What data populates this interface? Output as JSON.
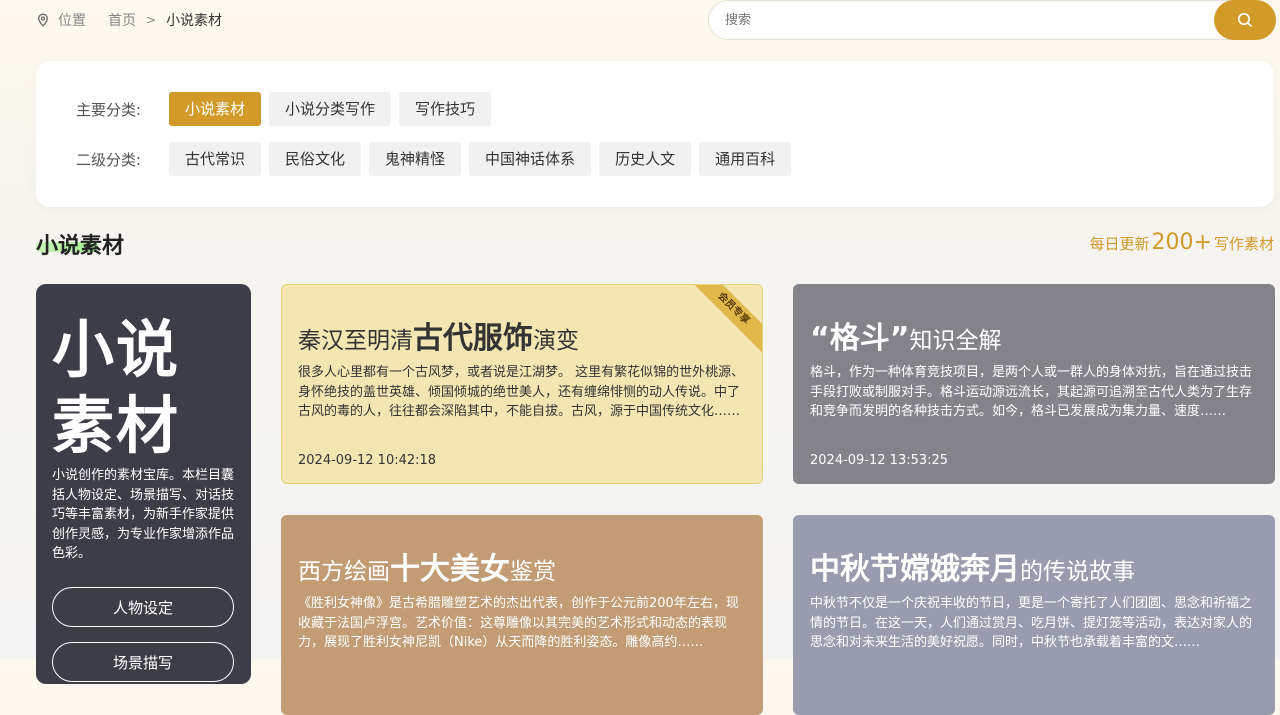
{
  "breadcrumb": {
    "location": "位置",
    "home": "首页",
    "separator": ">",
    "current": "小说素材"
  },
  "search": {
    "placeholder": "搜索"
  },
  "filters": {
    "primary_label": "主要分类:",
    "primary": [
      "小说素材",
      "小说分类写作",
      "写作技巧"
    ],
    "primary_active": "小说素材",
    "secondary_label": "二级分类:",
    "secondary": [
      "古代常识",
      "民俗文化",
      "鬼神精怪",
      "中国神话体系",
      "历史人文",
      "通用百科"
    ]
  },
  "section": {
    "title": "小说素材",
    "update_prefix": "每日更新",
    "update_count": "200+",
    "update_suffix": "写作素材"
  },
  "intro": {
    "line1": "小说",
    "line2": "素材",
    "description": "小说创作的素材宝库。本栏目囊括人物设定、场景描写、对话技巧等丰富素材，为新手作家提供创作灵感，为专业作家增添作品色彩。",
    "buttons": [
      "人物设定",
      "场景描写"
    ]
  },
  "cards": [
    {
      "title_pre": "秦汉至明清",
      "title_bold": "古代服饰",
      "title_post": "演变",
      "excerpt": "很多人心里都有一个古风梦，或者说是江湖梦。 这里有繁花似锦的世外桃源、身怀绝技的盖世英雄、倾国倾城的绝世美人，还有缠绵悱恻的动人传说。中了古风的毒的人，往往都会深陷其中，不能自拔。古风，源于中国传统文化……",
      "date": "2024-09-12 10:42:18",
      "badge": "会员专享",
      "bg": "#f3e6b3",
      "border": "#e8d27e",
      "color": "#333"
    },
    {
      "title_pre": "",
      "title_bold": "“格斗”",
      "title_post": "知识全解",
      "excerpt": "格斗，作为一种体育竞技项目，是两个人或一群人的身体对抗，旨在通过技击手段打败或制服对手。格斗运动源远流长，其起源可追溯至古代人类为了生存和竞争而发明的各种技击方式。如今，格斗已发展成为集力量、速度……",
      "date": "2024-09-12 13:53:25",
      "badge": "",
      "bg": "#848389",
      "border": "#848389",
      "color": "#ffffff"
    },
    {
      "title_pre": "西方绘画",
      "title_bold": "十大美女",
      "title_post": "鉴赏",
      "excerpt": "《胜利女神像》是古希腊雕塑艺术的杰出代表，创作于公元前200年左右，现收藏于法国卢浮宫。艺术价值：这尊雕像以其完美的艺术形式和动态的表现力，展现了胜利女神尼凯（Nike）从天而降的胜利姿态。雕像高约……",
      "date": "",
      "badge": "",
      "bg": "#c19c74",
      "border": "#c19c74",
      "color": "#ffffff"
    },
    {
      "title_pre": "",
      "title_bold": "中秋节嫦娥奔月",
      "title_post": "的传说故事",
      "excerpt": "中秋节不仅是一个庆祝丰收的节日，更是一个寄托了人们团圆、思念和祈福之情的节日。在这一天，人们通过赏月、吃月饼、提灯笼等活动，表达对家人的思念和对未来生活的美好祝愿。同时，中秋节也承载着丰富的文……",
      "date": "",
      "badge": "",
      "bg": "#999caf",
      "border": "#999caf",
      "color": "#ffffff"
    }
  ],
  "colors": {
    "accent": "#d29a29",
    "intro_bg": "#3c3d47"
  }
}
